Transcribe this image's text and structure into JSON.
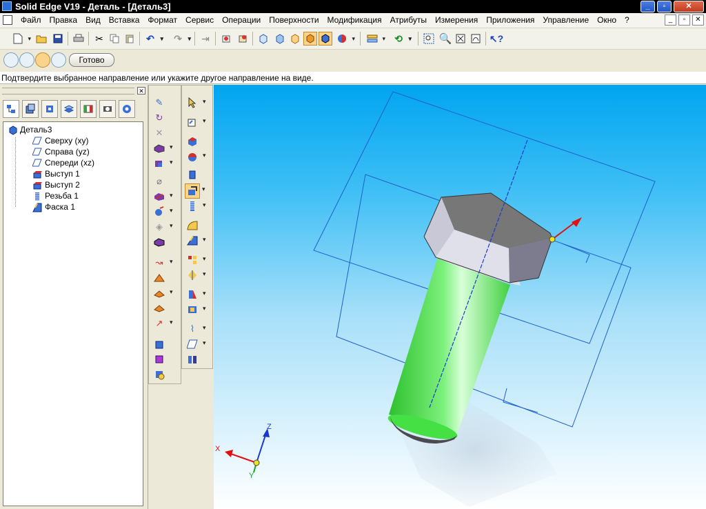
{
  "window": {
    "title": "Solid Edge V19 - Деталь - [Деталь3]",
    "buttons": {
      "minimize": "_",
      "restore": "▫",
      "close": "✕"
    }
  },
  "menu": {
    "items": [
      "Файл",
      "Правка",
      "Вид",
      "Вставка",
      "Формат",
      "Сервис",
      "Операции",
      "Поверхности",
      "Модификация",
      "Атрибуты",
      "Измерения",
      "Приложения",
      "Управление",
      "Окно",
      "?"
    ]
  },
  "toolbar": {
    "icons": [
      "new-icon",
      "open-icon",
      "save-icon",
      "print-icon",
      "cut-icon",
      "copy-icon",
      "paste-icon",
      "undo-icon",
      "redo-icon",
      "import-icon",
      "select-tool-icon",
      "part-icon",
      "view-front-icon",
      "view-iso-icon",
      "shaded-icon",
      "shaded-edges-icon",
      "render-icon",
      "layers-icon",
      "rotate-icon",
      "zoom-area-icon",
      "zoom-icon",
      "fit-icon",
      "pan-icon",
      "help-icon"
    ]
  },
  "ribbon": {
    "done_label": "Готово"
  },
  "prompt": {
    "text": "Подтвердите выбранное направление или укажите другое направление на виде."
  },
  "tree": {
    "root": "Деталь3",
    "items": [
      {
        "label": "Сверху (xy)",
        "icon": "plane-icon"
      },
      {
        "label": "Справа (yz)",
        "icon": "plane-icon"
      },
      {
        "label": "Спереди (xz)",
        "icon": "plane-icon"
      },
      {
        "label": "Выступ 1",
        "icon": "protrusion-icon"
      },
      {
        "label": "Выступ 2",
        "icon": "protrusion-icon"
      },
      {
        "label": "Резьба 1",
        "icon": "thread-icon"
      },
      {
        "label": "Фаска 1",
        "icon": "chamfer-icon"
      }
    ]
  },
  "viewport": {
    "axes": {
      "x": "X",
      "y": "Y",
      "z": "Z"
    },
    "colors": {
      "body": "#44e044",
      "head_top": "#7a7a7a",
      "head_front": "#dcdce6",
      "head_side": "#8a8a9a",
      "planes": "#3a6fd6",
      "direction_arrow": "#e01010"
    }
  }
}
